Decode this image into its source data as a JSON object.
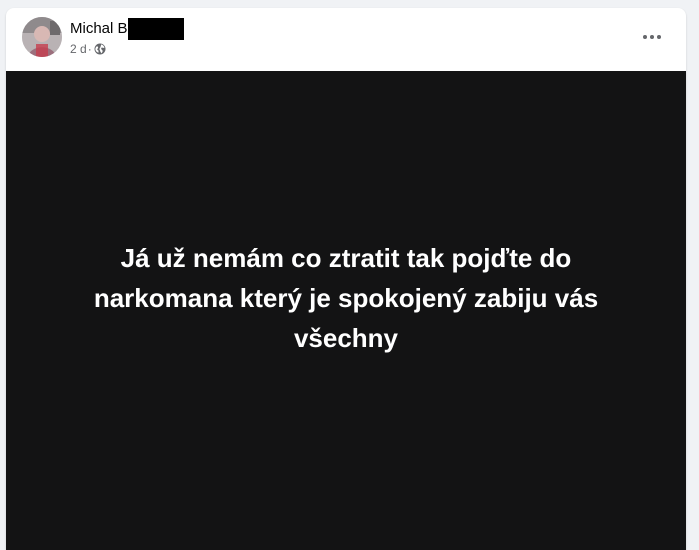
{
  "post": {
    "author_name": "Michal B",
    "author_redacted": true,
    "time": "2 d",
    "meta_separator": "·",
    "audience_icon": "globe-icon",
    "more_icon": "more-options-icon",
    "text": "Já už nemám co ztratit tak pojďte do\nnarkomana který je spokojený zabiju vás\nvšechny",
    "background_color": "#131314",
    "text_color": "#ffffff"
  }
}
